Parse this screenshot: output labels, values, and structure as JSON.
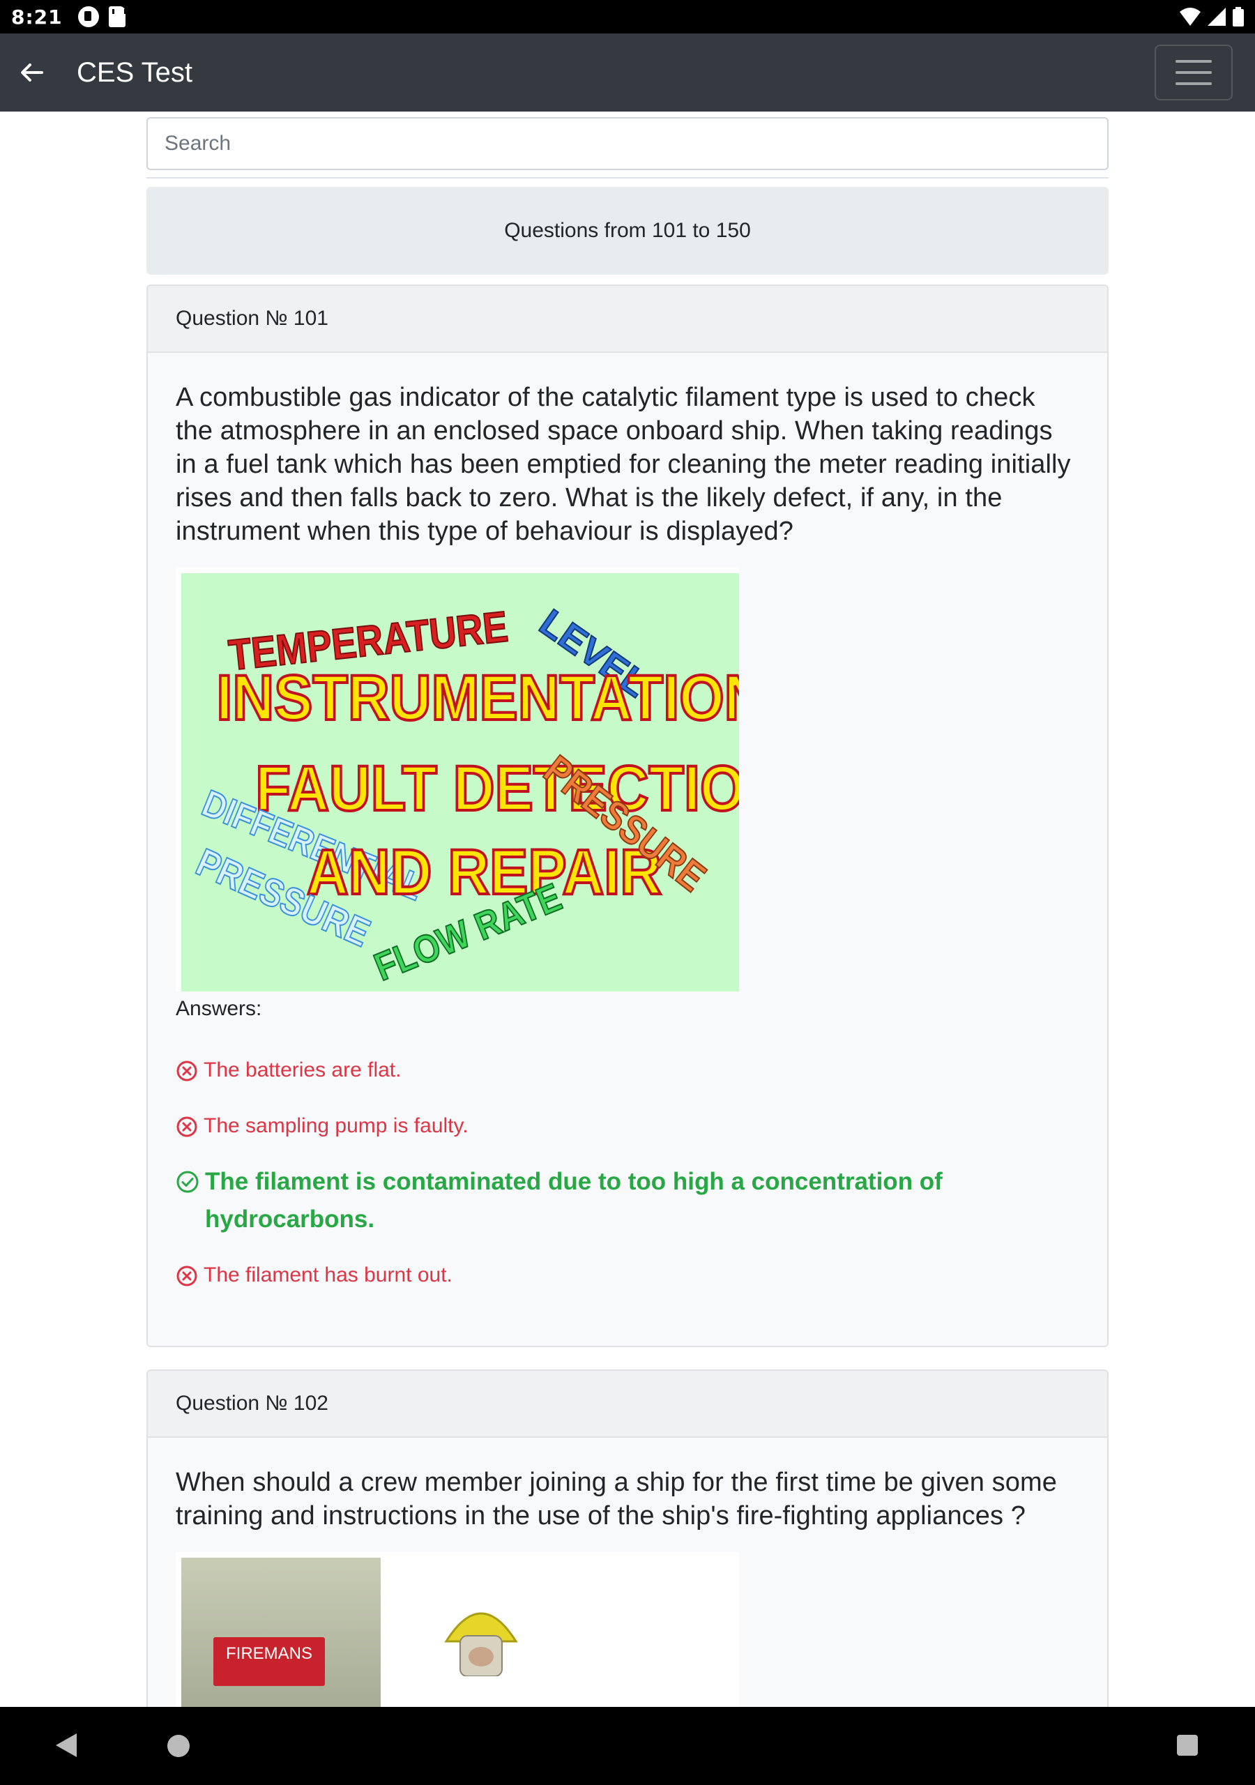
{
  "status_bar": {
    "time": "8:21"
  },
  "app_bar": {
    "title": "CES Test"
  },
  "search": {
    "placeholder": "Search",
    "value": ""
  },
  "range_banner": "Questions from 101 to 150",
  "questions": [
    {
      "header": "Question № 101",
      "text": "A combustible gas indicator of the catalytic filament type is used to check the atmosphere in an enclosed space onboard ship. When taking readings in a fuel tank which has been emptied for cleaning the meter reading initially rises and then falls back to zero. What is the likely defect, if any, in the instrument when this type of behaviour is displayed?",
      "image_words": {
        "temperature": "TEMPERATURE",
        "level": "LEVEL",
        "instrumentation": "INSTRUMENTATION",
        "fault_detection": "FAULT DETECTION",
        "and_repair": "AND REPAIR",
        "differential": "DIFFERENTIAL",
        "pressure_left": "PRESSURE",
        "pressure_right": "PRESSURE",
        "flow_rate": "FLOW RATE"
      },
      "answers_label": "Answers:",
      "answers": [
        {
          "text": "The batteries are flat.",
          "correct": false
        },
        {
          "text": "The sampling pump is faulty.",
          "correct": false
        },
        {
          "text": "The filament is contaminated due to too high a concentration of hydrocarbons.",
          "correct": true
        },
        {
          "text": "The filament has burnt out.",
          "correct": false
        }
      ]
    },
    {
      "header": "Question № 102",
      "text": "When should a crew member joining a ship for the first time be given some training and instructions in the use of the ship's fire-fighting appliances ?",
      "image_words": {
        "sign": "FIREMANS"
      }
    }
  ],
  "colors": {
    "app_bar": "#343a40",
    "wrong_answer": "#dc3545",
    "correct_answer": "#28a745",
    "image_background": "#c6fac8"
  }
}
